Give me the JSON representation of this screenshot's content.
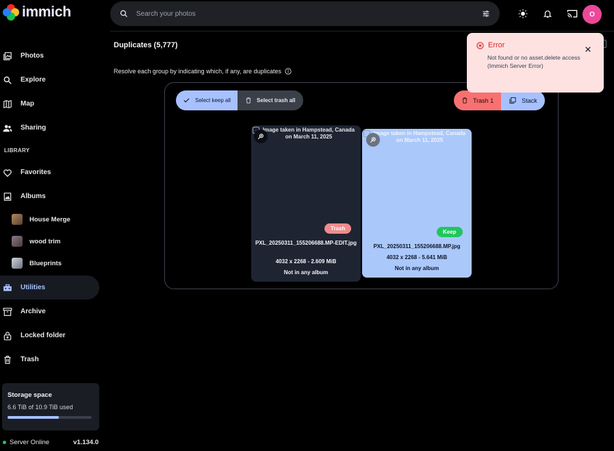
{
  "app": {
    "logo_text": "immich",
    "search_placeholder": "Search your photos",
    "avatar_initial": "O"
  },
  "sidebar": {
    "nav_top": [
      {
        "label": "Photos",
        "icon": "photos-icon"
      },
      {
        "label": "Explore",
        "icon": "explore-icon"
      },
      {
        "label": "Map",
        "icon": "map-icon"
      },
      {
        "label": "Sharing",
        "icon": "sharing-icon"
      }
    ],
    "library_heading": "LIBRARY",
    "favorites": "Favorites",
    "albums": "Albums",
    "album_items": [
      {
        "label": "House Merge",
        "color": "#8a6a4a"
      },
      {
        "label": "wood trim",
        "color": "#7a6a7a"
      },
      {
        "label": "Blueprints",
        "color": "#9ca3af"
      }
    ],
    "utilities": "Utilities",
    "archive": "Archive",
    "locked_folder": "Locked folder",
    "trash": "Trash",
    "storage": {
      "title": "Storage space",
      "usage": "6.6 TiB of 10.9 TiB used",
      "fraction": 0.606
    },
    "server_status": "Server Online",
    "version": "v1.134.0"
  },
  "main": {
    "title": "Duplicates (5,777)",
    "instruction": "Resolve each group by indicating which, if any, are duplicates",
    "select_keep_all": "Select keep all",
    "select_trash_all": "Select trash all",
    "trash_button": "Trash 1",
    "stack_button": "Stack",
    "cards": [
      {
        "alt": "Image taken in Hampstead, Canada on March 11, 2025",
        "badge": "Trash",
        "filename": "PXL_20250311_155206688.MP-EDIT.jpg",
        "dimensions": "4032 x 2268 - 2.609 MiB",
        "album": "Not in any album"
      },
      {
        "alt": "Image taken in Hampstead, Canada on March 11, 2025",
        "badge": "Keep",
        "filename": "PXL_20250311_155206688.MP.jpg",
        "dimensions": "4032 x 2268 - 5.641 MiB",
        "album": "Not in any album"
      }
    ]
  },
  "toast": {
    "label": "Error",
    "message_line1": "Not found or no asset.delete access",
    "message_line2": "(Immich Server Error)"
  },
  "colors": {
    "accent": "#a7c1ff",
    "error": "#dc2626",
    "keep": "#22c55e",
    "trash": "#f87171"
  }
}
